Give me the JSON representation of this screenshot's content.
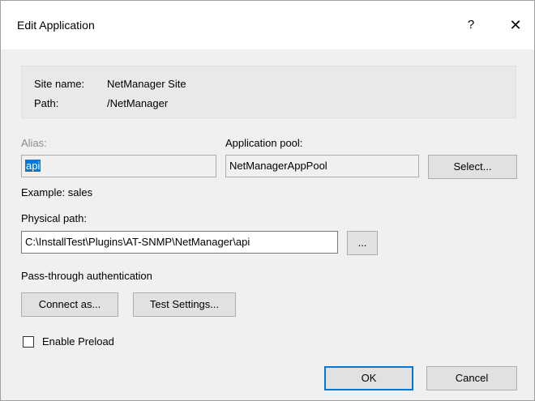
{
  "dialog": {
    "title": "Edit Application",
    "help_glyph": "?",
    "close_glyph": "✕"
  },
  "info": {
    "site_name_label": "Site name:",
    "site_name_value": "NetManager Site",
    "path_label": "Path:",
    "path_value": "/NetManager"
  },
  "alias": {
    "label": "Alias:",
    "value": "api",
    "example": "Example: sales"
  },
  "app_pool": {
    "label": "Application pool:",
    "value": "NetManagerAppPool",
    "select_label": "Select..."
  },
  "physical_path": {
    "label": "Physical path:",
    "value": "C:\\InstallTest\\Plugins\\AT-SNMP\\NetManager\\api",
    "browse_label": "..."
  },
  "auth": {
    "label": "Pass-through authentication",
    "connect_as_label": "Connect as...",
    "test_settings_label": "Test Settings..."
  },
  "preload": {
    "label": "Enable Preload",
    "checked": false
  },
  "footer": {
    "ok_label": "OK",
    "cancel_label": "Cancel"
  },
  "colors": {
    "accent": "#0078d7",
    "selection_text": "#ffffff",
    "disabled_text": "#8c8c8c"
  }
}
